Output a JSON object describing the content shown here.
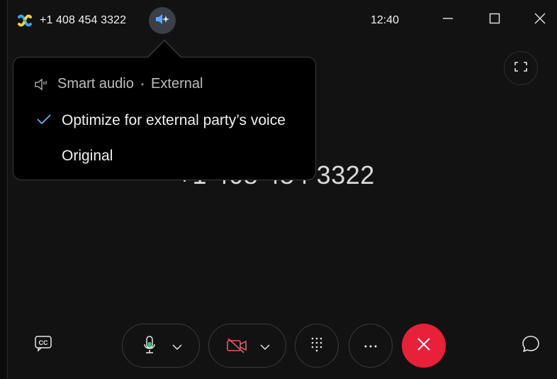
{
  "titlebar": {
    "phone_number": "+1 408 454 3322",
    "clock": "12:40",
    "icons": {
      "app": "webex-logo-icon",
      "smart_audio": "smart-audio-icon",
      "minimize": "minimize-icon",
      "maximize": "maximize-icon",
      "close": "close-icon"
    }
  },
  "call": {
    "display_number": "+1 408 454 3322"
  },
  "smart_audio_menu": {
    "header_label": "Smart audio",
    "header_separator": "•",
    "header_mode": "External",
    "options": [
      {
        "label": "Optimize for external party’s voice",
        "selected": true
      },
      {
        "label": "Original",
        "selected": false
      }
    ]
  },
  "controls": {
    "captions": "closed-captions-icon",
    "microphone": "microphone-icon",
    "video": "video-off-icon",
    "keypad": "keypad-icon",
    "more": "more-icon",
    "end_call": "end-call-icon",
    "chat": "chat-icon"
  },
  "colors": {
    "end_call": "#e8203a",
    "check": "#6fb6ff",
    "video_off": "#e05a6a",
    "mic_level": "#3fbf7f"
  }
}
